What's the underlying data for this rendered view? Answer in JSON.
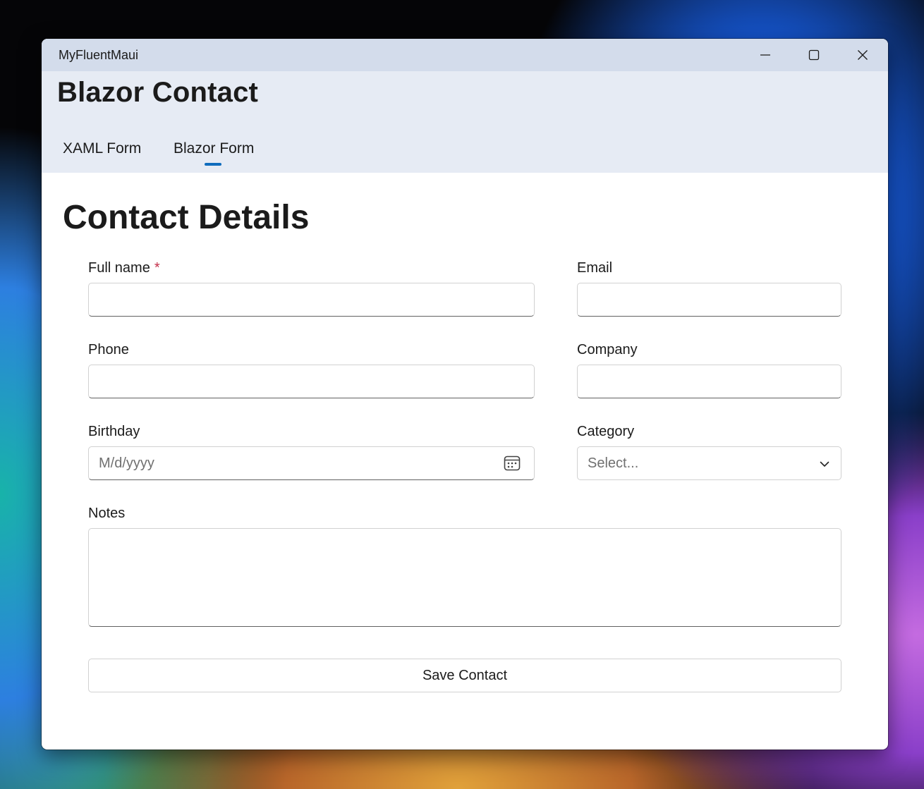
{
  "window": {
    "app_title": "MyFluentMaui",
    "controls": {
      "minimize": "minimize-icon",
      "maximize": "maximize-icon",
      "close": "close-icon"
    }
  },
  "header": {
    "title": "Blazor Contact",
    "tabs": [
      {
        "label": "XAML Form",
        "selected": false
      },
      {
        "label": "Blazor Form",
        "selected": true
      }
    ],
    "accent_color": "#0f6cbd"
  },
  "form": {
    "title": "Contact Details",
    "full_name": {
      "label": "Full name",
      "required_marker": "*",
      "value": ""
    },
    "email": {
      "label": "Email",
      "value": ""
    },
    "phone": {
      "label": "Phone",
      "value": ""
    },
    "company": {
      "label": "Company",
      "value": ""
    },
    "birthday": {
      "label": "Birthday",
      "placeholder": "M/d/yyyy",
      "value": "",
      "icon": "calendar-icon"
    },
    "category": {
      "label": "Category",
      "selected": "Select...",
      "icon": "chevron-down-icon"
    },
    "notes": {
      "label": "Notes",
      "value": ""
    },
    "save_label": "Save Contact"
  }
}
